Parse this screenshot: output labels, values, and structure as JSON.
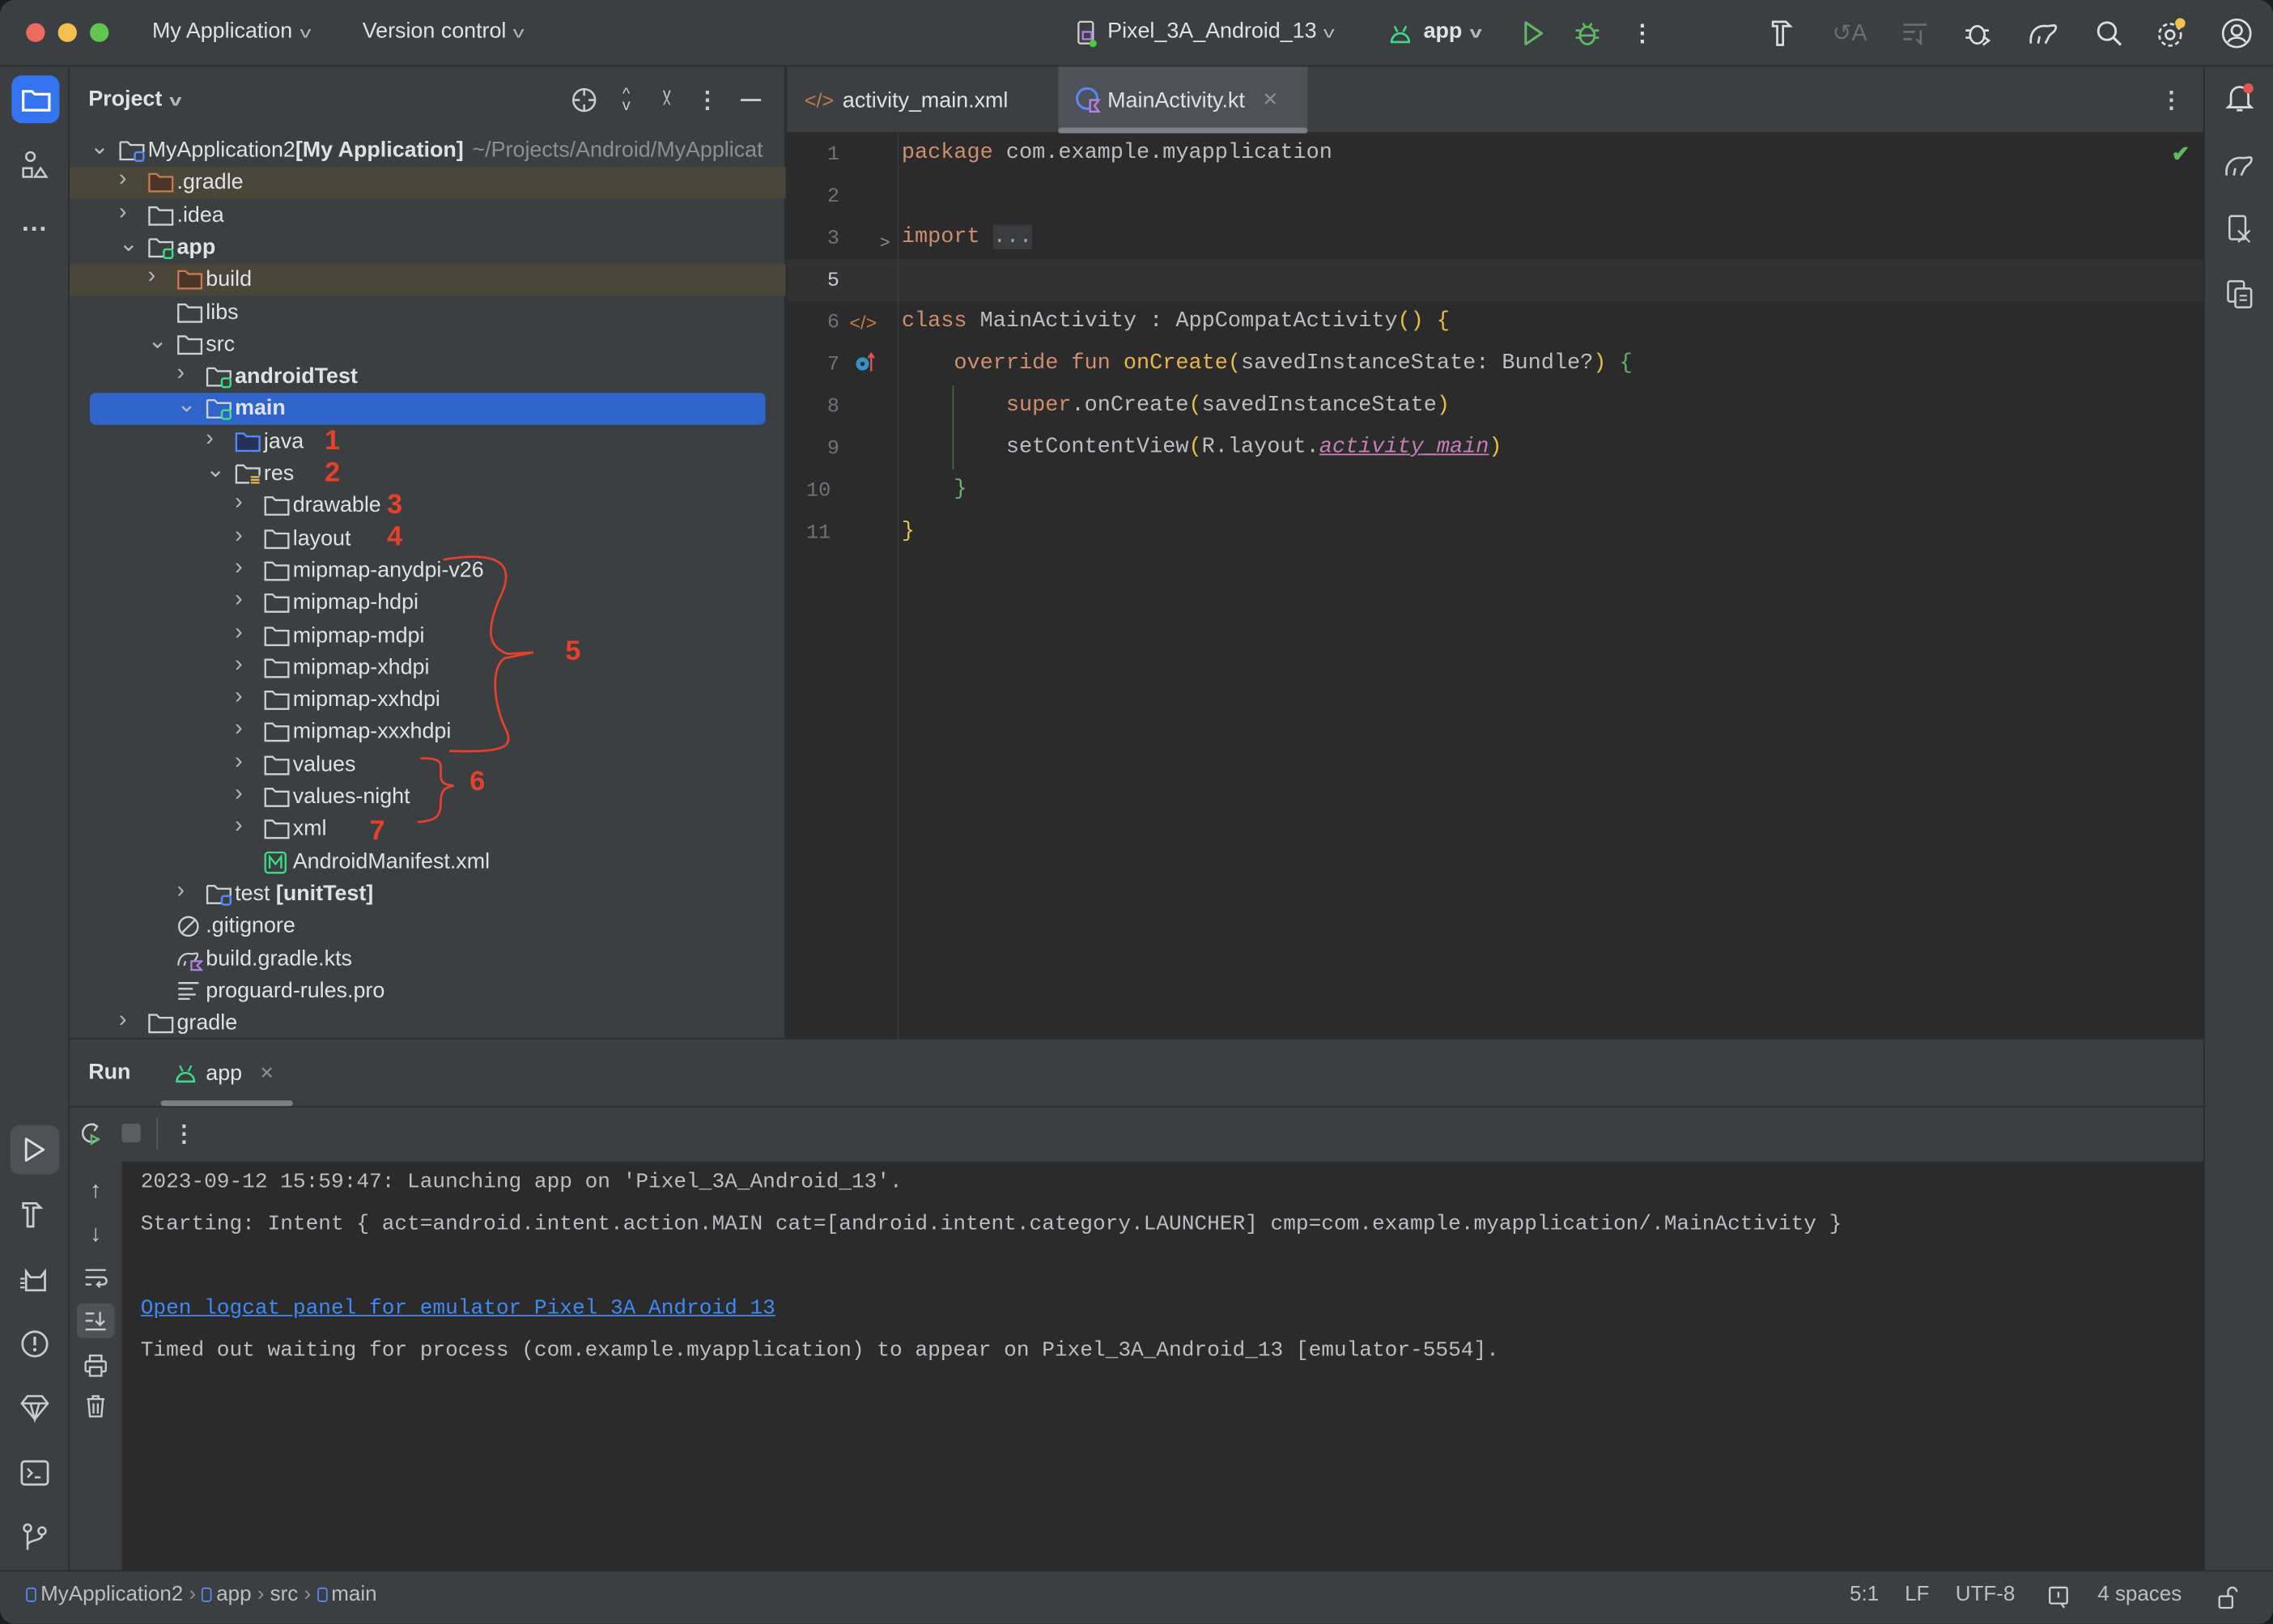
{
  "titlebar": {
    "project_menu": "My Application",
    "vcs_menu": "Version control",
    "device": "Pixel_3A_Android_13",
    "run_config": "app"
  },
  "colors": {
    "accent": "#2f65ca",
    "link": "#3d8af7",
    "annotation": "#e8402a",
    "run_green": "#5fb865"
  },
  "project_panel": {
    "title": "Project",
    "tree": [
      {
        "label": "MyApplication2",
        "bold": "[My Application]",
        "hint": "~/Projects/Android/MyApplicat",
        "level": 0,
        "state": "open",
        "icon": "module-folder"
      },
      {
        "label": ".gradle",
        "level": 1,
        "state": "closed",
        "icon": "excluded-folder",
        "highlight": true
      },
      {
        "label": ".idea",
        "level": 1,
        "state": "closed",
        "icon": "folder"
      },
      {
        "label": "",
        "bold": "app",
        "level": 1,
        "state": "open",
        "icon": "android-module-folder"
      },
      {
        "label": "build",
        "level": 2,
        "state": "closed",
        "icon": "excluded-folder",
        "highlight": true
      },
      {
        "label": "libs",
        "level": 2,
        "state": "leaf",
        "icon": "folder"
      },
      {
        "label": "src",
        "level": 2,
        "state": "open",
        "icon": "folder"
      },
      {
        "label": "",
        "bold": "androidTest",
        "level": 3,
        "state": "closed",
        "icon": "android-module-folder"
      },
      {
        "label": "",
        "bold": "main",
        "level": 3,
        "state": "open",
        "icon": "android-module-folder",
        "selected": true
      },
      {
        "label": "java",
        "level": 4,
        "state": "closed",
        "icon": "source-folder"
      },
      {
        "label": "res",
        "level": 4,
        "state": "open",
        "icon": "resource-folder"
      },
      {
        "label": "drawable",
        "level": 5,
        "state": "closed",
        "icon": "folder"
      },
      {
        "label": "layout",
        "level": 5,
        "state": "closed",
        "icon": "folder"
      },
      {
        "label": "mipmap-anydpi-v26",
        "level": 5,
        "state": "closed",
        "icon": "folder"
      },
      {
        "label": "mipmap-hdpi",
        "level": 5,
        "state": "closed",
        "icon": "folder"
      },
      {
        "label": "mipmap-mdpi",
        "level": 5,
        "state": "closed",
        "icon": "folder"
      },
      {
        "label": "mipmap-xhdpi",
        "level": 5,
        "state": "closed",
        "icon": "folder"
      },
      {
        "label": "mipmap-xxhdpi",
        "level": 5,
        "state": "closed",
        "icon": "folder"
      },
      {
        "label": "mipmap-xxxhdpi",
        "level": 5,
        "state": "closed",
        "icon": "folder"
      },
      {
        "label": "values",
        "level": 5,
        "state": "closed",
        "icon": "folder"
      },
      {
        "label": "values-night",
        "level": 5,
        "state": "closed",
        "icon": "folder"
      },
      {
        "label": "xml",
        "level": 5,
        "state": "closed",
        "icon": "folder"
      },
      {
        "label": "AndroidManifest.xml",
        "level": 5,
        "state": "leaf",
        "icon": "manifest-file"
      },
      {
        "label": "test ",
        "bold": "[unitTest]",
        "level": 3,
        "state": "closed",
        "icon": "test-module-folder"
      },
      {
        "label": ".gitignore",
        "level": 2,
        "state": "leaf",
        "icon": "ignore-file"
      },
      {
        "label": "build.gradle.kts",
        "level": 2,
        "state": "leaf",
        "icon": "gradle-kts-file"
      },
      {
        "label": "proguard-rules.pro",
        "level": 2,
        "state": "leaf",
        "icon": "text-file"
      },
      {
        "label": "gradle",
        "level": 1,
        "state": "closed",
        "icon": "folder"
      }
    ],
    "annotations": [
      "1",
      "2",
      "3",
      "4",
      "5",
      "6",
      "7"
    ]
  },
  "editor": {
    "tabs": [
      {
        "label": "activity_main.xml",
        "icon": "xml-icon",
        "active": false
      },
      {
        "label": "MainActivity.kt",
        "icon": "kotlin-class-icon",
        "active": true
      }
    ],
    "current_line": 5,
    "lines": [
      {
        "n": "1",
        "tokens": [
          [
            "package",
            "k"
          ],
          [
            " com.example.myapplication",
            ""
          ]
        ]
      },
      {
        "n": "2",
        "tokens": []
      },
      {
        "n": "3",
        "tokens": [
          [
            "import",
            "k"
          ],
          [
            " ",
            ""
          ],
          [
            "...",
            "fold"
          ]
        ]
      },
      {
        "n": "5",
        "tokens": []
      },
      {
        "n": "6",
        "tokens": [
          [
            "class",
            "k"
          ],
          [
            " MainActivity : AppCompatActivity",
            ""
          ],
          [
            "()",
            "p"
          ],
          [
            " ",
            ""
          ],
          [
            "{",
            "p"
          ]
        ]
      },
      {
        "n": "7",
        "tokens": [
          [
            "    override fun ",
            "k"
          ],
          [
            "onCreate",
            "fn"
          ],
          [
            "(",
            "p"
          ],
          [
            "savedInstanceState: Bundle?",
            ""
          ],
          [
            ")",
            "p"
          ],
          [
            " ",
            ""
          ],
          [
            "{",
            "pg"
          ]
        ]
      },
      {
        "n": "8",
        "tokens": [
          [
            "        super",
            "k"
          ],
          [
            ".onCreate",
            ""
          ],
          [
            "(",
            "p"
          ],
          [
            "savedInstanceState",
            ""
          ],
          [
            ")",
            "p"
          ]
        ]
      },
      {
        "n": "9",
        "tokens": [
          [
            "        setContentView",
            ""
          ],
          [
            "(",
            "p"
          ],
          [
            "R.layout.",
            ""
          ],
          [
            "activity_main",
            "pu"
          ],
          [
            ")",
            "p"
          ]
        ]
      },
      {
        "n": "10",
        "tokens": [
          [
            "    ",
            ""
          ],
          [
            "}",
            "pg"
          ]
        ]
      },
      {
        "n": "11",
        "tokens": [
          [
            "}",
            "p"
          ]
        ]
      }
    ]
  },
  "run_panel": {
    "title": "Run",
    "tab": "app",
    "console": [
      {
        "text": "2023-09-12 15:59:47: Launching app on 'Pixel_3A_Android_13'."
      },
      {
        "text": "Starting: Intent { act=android.intent.action.MAIN cat=[android.intent.category.LAUNCHER] cmp=com.example.myapplication/.MainActivity }"
      },
      {
        "text": ""
      },
      {
        "text": "Open logcat panel for emulator Pixel 3A Android 13",
        "link": true
      },
      {
        "text": "Timed out waiting for process (com.example.myapplication) to appear on Pixel_3A_Android_13 [emulator-5554]."
      }
    ]
  },
  "statusbar": {
    "breadcrumbs": [
      "MyApplication2",
      "app",
      "src",
      "main"
    ],
    "position": "5:1",
    "line_separator": "LF",
    "encoding": "UTF-8",
    "indent": "4 spaces"
  }
}
